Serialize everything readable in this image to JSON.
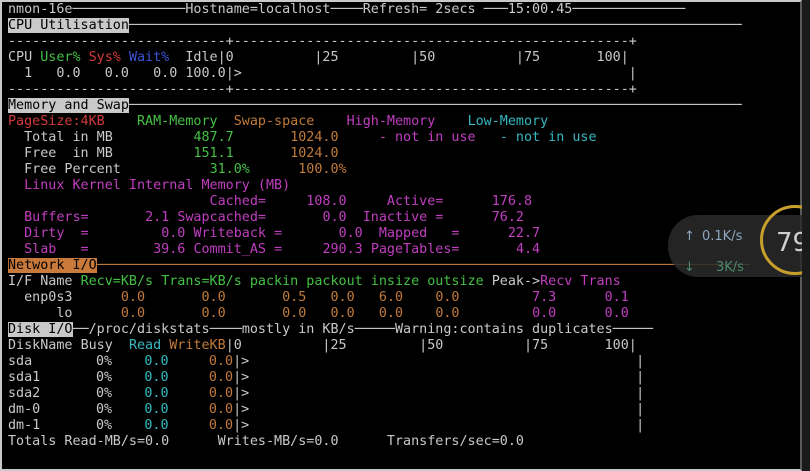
{
  "title_bar": {
    "app": "nmon-16e",
    "hostname": "Hostname=localhost",
    "refresh": "Refresh= 2secs",
    "time": "15:00.45"
  },
  "cpu": {
    "section": "CPU Utilisation",
    "ruler_top": "---------------------------+-------------------------------------------------+",
    "col_cpu": "CPU",
    "col_user": "User%",
    "col_sys": "Sys%",
    "col_wait": "Wait%",
    "col_idle": "Idle",
    "scale": "|0          |25         |50          |75       100|",
    "row_cpu": "1",
    "row_user": "0.0",
    "row_sys": "0.0",
    "row_wait": "0.0",
    "row_idle": "100.0",
    "row_bar": "|>                                                |",
    "ruler_bottom": "---------------------------+-------------------------------------------------+"
  },
  "memory": {
    "section": "Memory and Swap",
    "pagesize": "PageSize:4KB",
    "col_ram": "RAM-Memory",
    "col_swap": "Swap-space",
    "col_high": "High-Memory",
    "col_low": "Low-Memory",
    "rows": [
      {
        "label": "Total in MB",
        "ram": "487.7",
        "swap": "1024.0",
        "high": "- not in use",
        "low": "- not in use"
      },
      {
        "label": "Free  in MB",
        "ram": "151.1",
        "swap": "1024.0",
        "high": "",
        "low": ""
      },
      {
        "label": "Free Percent",
        "ram": "31.0%",
        "swap": "100.0%",
        "high": "",
        "low": ""
      }
    ],
    "kernel_title": "Linux Kernel Internal Memory (MB)",
    "k_cached_label": "Cached=",
    "k_cached": "108.0",
    "k_active_label": "Active=",
    "k_active": "176.8",
    "k_buffers_label": "Buffers=",
    "k_buffers": "2.1",
    "k_swapcached_label": "Swapcached=",
    "k_swapcached": "0.0",
    "k_inactive_label": "Inactive =",
    "k_inactive": "76.2",
    "k_dirty_label": "Dirty  =",
    "k_dirty": "0.0",
    "k_writeback_label": "Writeback =",
    "k_writeback": "0.0",
    "k_mapped_label": "Mapped   =",
    "k_mapped": "22.7",
    "k_slab_label": "Slab   =",
    "k_slab": "39.6",
    "k_commit_label": "Commit_AS =",
    "k_commit": "290.3",
    "k_pagetables_label": "PageTables=",
    "k_pagetables": "4.4"
  },
  "network": {
    "section": "Network I/O",
    "h_ifname": "I/F Name",
    "h_recv": "Recv=KB/s",
    "h_trans": "Trans=KB/s",
    "h_rest": "packin packout insize outsize",
    "h_peak": "Peak->",
    "h_peak_recv": "Recv",
    "h_peak_trans": "Trans",
    "rows": [
      {
        "name": "enp0s3",
        "recv": "0.0",
        "trans": "0.0",
        "packin": "0.5",
        "packout": "0.0",
        "insize": "6.0",
        "outsize": "0.0",
        "peak_recv": "7.3",
        "peak_trans": "0.1"
      },
      {
        "name": "lo",
        "recv": "0.0",
        "trans": "0.0",
        "packin": "0.0",
        "packout": "0.0",
        "insize": "0.0",
        "outsize": "0.0",
        "peak_recv": "0.0",
        "peak_trans": "0.0"
      }
    ]
  },
  "disk": {
    "section": "Disk I/O",
    "header_rest": "/proc/diskstats",
    "header_unit": "mostly in KB/s",
    "header_warn": "Warning:contains duplicates",
    "h_name": "DiskName",
    "h_busy": "Busy",
    "h_read": "Read",
    "h_write": "WriteKB",
    "scale": "|0          |25         |50          |75       100|",
    "rows": [
      {
        "name": "sda",
        "busy": "0%",
        "read": "0.0",
        "write": "0.0",
        "bar": "|>                                                |"
      },
      {
        "name": "sda1",
        "busy": "0%",
        "read": "0.0",
        "write": "0.0",
        "bar": "|>                                                |"
      },
      {
        "name": "sda2",
        "busy": "0%",
        "read": "0.0",
        "write": "0.0",
        "bar": "|>                                                |"
      },
      {
        "name": "dm-0",
        "busy": "0%",
        "read": "0.0",
        "write": "0.0",
        "bar": "|>                                                |"
      },
      {
        "name": "dm-1",
        "busy": "0%",
        "read": "0.0",
        "write": "0.0",
        "bar": "|>                                                |"
      }
    ],
    "totals": "Totals Read-MB/s=0.0      Writes-MB/s=0.0      Transfers/sec=0.0"
  },
  "overlay_widget": {
    "up_rate": "0.1K/s",
    "down_rate": "3K/s",
    "gauge": "79"
  }
}
